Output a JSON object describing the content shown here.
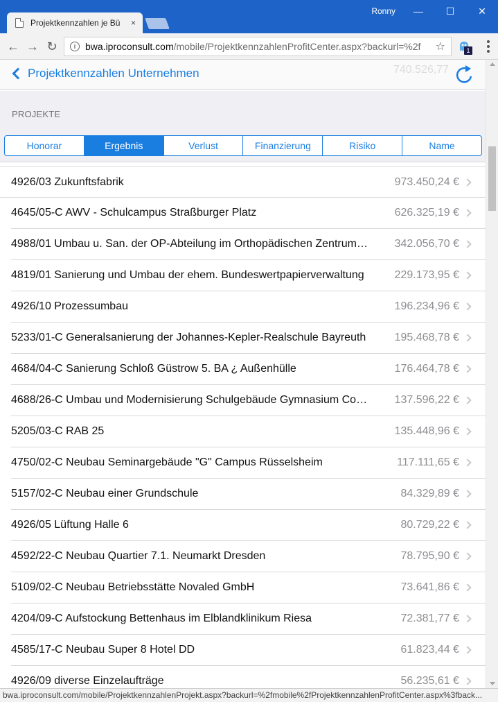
{
  "window": {
    "user": "Ronny",
    "tab_title": "Projektkennzahlen je Bür",
    "tab_close": "×",
    "controls": {
      "minimize": "—",
      "maximize": "☐",
      "close": "✕"
    }
  },
  "toolbar": {
    "back": "←",
    "forward": "→",
    "reload": "↻",
    "url_host": "bwa.iproconsult.com",
    "url_path": "/mobile/ProjektkennzahlenProfitCenter.aspx?backurl=%2f",
    "star": "☆",
    "ext_badge": "1"
  },
  "header": {
    "back_label": "Projektkennzahlen Unternehmen",
    "ghost_value": "740.526,77"
  },
  "section": {
    "label": "PROJEKTE",
    "tabs": [
      {
        "label": "Honorar",
        "active": false
      },
      {
        "label": "Ergebnis",
        "active": true
      },
      {
        "label": "Verlust",
        "active": false
      },
      {
        "label": "Finanzierung",
        "active": false
      },
      {
        "label": "Risiko",
        "active": false
      },
      {
        "label": "Name",
        "active": false
      }
    ]
  },
  "projects": [
    {
      "name": "4926/03 Zukunftsfabrik",
      "value": "973.450,24 €"
    },
    {
      "name": "4645/05-C AWV - Schulcampus Straßburger Platz",
      "value": "626.325,19 €"
    },
    {
      "name": "4988/01 Umbau u. San. der OP-Abteilung im Orthopädischen Zentrum…",
      "value": "342.056,70 €"
    },
    {
      "name": "4819/01 Sanierung und Umbau der ehem. Bundeswertpapierverwaltung",
      "value": "229.173,95 €"
    },
    {
      "name": "4926/10 Prozessumbau",
      "value": "196.234,96 €"
    },
    {
      "name": "5233/01-C Generalsanierung der Johannes-Kepler-Realschule Bayreuth",
      "value": "195.468,78 €"
    },
    {
      "name": "4684/04-C Sanierung Schloß Güstrow 5. BA ¿ Außenhülle",
      "value": "176.464,78 €"
    },
    {
      "name": "4688/26-C Umbau und Modernisierung Schulgebäude Gymnasium Co…",
      "value": "137.596,22 €"
    },
    {
      "name": "5205/03-C RAB 25",
      "value": "135.448,96 €"
    },
    {
      "name": "4750/02-C Neubau Seminargebäude \"G\" Campus Rüsselsheim",
      "value": "117.111,65 €"
    },
    {
      "name": "5157/02-C Neubau einer Grundschule",
      "value": "84.329,89 €"
    },
    {
      "name": "4926/05 Lüftung Halle 6",
      "value": "80.729,22 €"
    },
    {
      "name": "4592/22-C Neubau Quartier 7.1. Neumarkt Dresden",
      "value": "78.795,90 €"
    },
    {
      "name": "5109/02-C Neubau Betriebsstätte Novaled GmbH",
      "value": "73.641,86 €"
    },
    {
      "name": "4204/09-C Aufstockung Bettenhaus im Elblandklinikum Riesa",
      "value": "72.381,77 €"
    },
    {
      "name": "4585/17-C Neubau Super 8 Hotel DD",
      "value": "61.823,44 €"
    },
    {
      "name": "4926/09 diverse Einzelaufträge",
      "value": "56.235,61 €"
    }
  ],
  "status_url": "bwa.iproconsult.com/mobile/ProjektkennzahlenProjekt.aspx?backurl=%2fmobile%2fProjektkennzahlenProfitCenter.aspx%3fback...",
  "colors": {
    "accent": "#1a7ee0",
    "titlebar": "#1e63c7",
    "section_bg": "#efeff4"
  }
}
